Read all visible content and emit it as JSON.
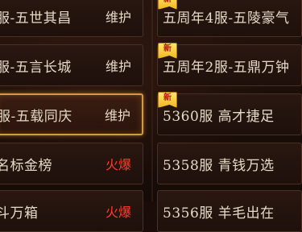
{
  "left_list": [
    {
      "name": "服-五世其昌",
      "status": "维护",
      "status_type": "maintenance",
      "selected": false
    },
    {
      "name": "服-五言长城",
      "status": "维护",
      "status_type": "maintenance",
      "selected": false
    },
    {
      "name": "服-五载同庆",
      "status": "维护",
      "status_type": "maintenance",
      "selected": true
    },
    {
      "name": "名标金榜",
      "status": "火爆",
      "status_type": "hot",
      "selected": false
    },
    {
      "name": "斗万箱",
      "status": "火爆",
      "status_type": "hot",
      "selected": false
    }
  ],
  "right_list": [
    {
      "name": "五周年4服-五陵豪气",
      "new_badge": "新"
    },
    {
      "name": "五周年2服-五鼎万钟",
      "new_badge": "新"
    },
    {
      "name": "5360服 高才捷足",
      "new_badge": "新"
    },
    {
      "name": "5358服 青钱万选",
      "new_badge": ""
    },
    {
      "name": "5356服 羊毛出在",
      "new_badge": ""
    }
  ],
  "colors": {
    "text": "#e6d9c7",
    "hot": "#ff3b2a",
    "selected_border": "#d39a45",
    "badge": "#f2b624"
  }
}
